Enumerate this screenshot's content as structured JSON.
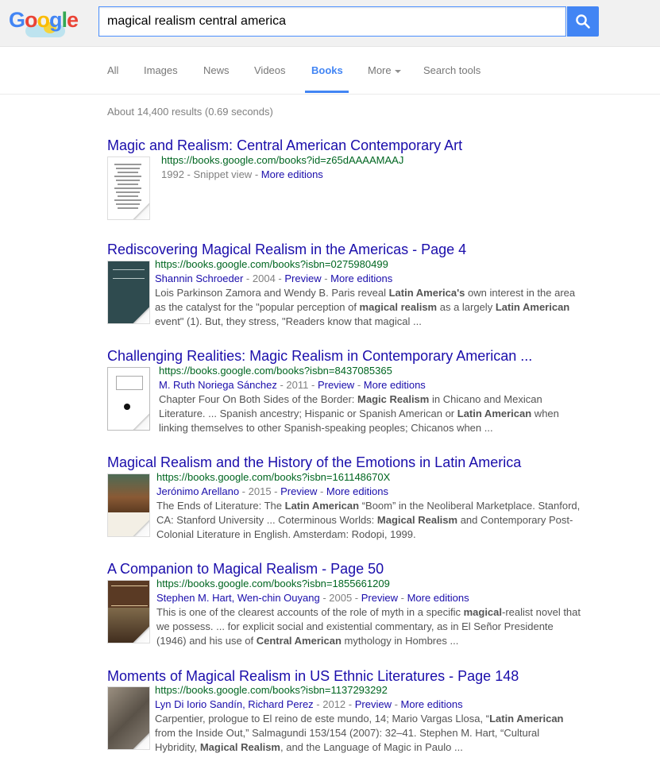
{
  "logo": {
    "letters": [
      "G",
      "o",
      "o",
      "g",
      "l",
      "e"
    ],
    "colors": [
      "#4285f4",
      "#ea4335",
      "#fbbc05",
      "#4285f4",
      "#34a853",
      "#ea4335"
    ]
  },
  "search": {
    "query": "magical realism central america",
    "button_icon": "magnifier-icon"
  },
  "tabs": [
    {
      "label": "All",
      "active": false
    },
    {
      "label": "Images",
      "active": false
    },
    {
      "label": "News",
      "active": false
    },
    {
      "label": "Videos",
      "active": false
    },
    {
      "label": "Books",
      "active": true
    },
    {
      "label": "More",
      "active": false
    },
    {
      "label": "Search tools",
      "active": false
    }
  ],
  "stats": "About 14,400 results (0.69 seconds)",
  "results": [
    {
      "title": "Magic and Realism: Central American Contemporary Art",
      "url": "https://books.google.com/books?id=z65dAAAAMAAJ",
      "authors": "",
      "year": "1992",
      "type": "Snippet view",
      "preview": "",
      "more": "More editions",
      "snippet": [],
      "thumb": {
        "style": "text",
        "bg": "#ffffff"
      }
    },
    {
      "title": "Rediscovering Magical Realism in the Americas - Page 4",
      "url": "https://books.google.com/books?isbn=0275980499",
      "authors": "Shannin Schroeder",
      "year": "2004",
      "type": "",
      "preview": "Preview",
      "more": "More editions",
      "snippet": [
        {
          "t": "Lois Parkinson Zamora and Wendy B. Paris reveal "
        },
        {
          "t": "Latin America's",
          "b": true
        },
        {
          "t": " own interest in the area as the catalyst for the \"popular perception of "
        },
        {
          "t": "magical realism",
          "b": true
        },
        {
          "t": " as a largely "
        },
        {
          "t": "Latin American",
          "b": true
        },
        {
          "t": " event\" (1). But, they stress, \"Readers know that magical ..."
        }
      ],
      "thumb": {
        "style": "dark",
        "bg": "#2f4b4f"
      }
    },
    {
      "title": "Challenging Realities: Magic Realism in Contemporary American ...",
      "url": "https://books.google.com/books?isbn=8437085365",
      "authors": "M. Ruth Noriega Sánchez",
      "year": "2011",
      "type": "",
      "preview": "Preview",
      "more": "More editions",
      "snippet": [
        {
          "t": "Chapter Four On Both Sides of the Border: "
        },
        {
          "t": "Magic Realism",
          "b": true
        },
        {
          "t": " in Chicano and Mexican Literature. ... Spanish ancestry; Hispanic or Spanish American or "
        },
        {
          "t": "Latin American",
          "b": true
        },
        {
          "t": " when linking themselves to other Spanish-speaking peoples; Chicanos when ..."
        }
      ],
      "thumb": {
        "style": "white-dot",
        "bg": "#ffffff"
      }
    },
    {
      "title": "Magical Realism and the History of the Emotions in Latin America",
      "url": "https://books.google.com/books?isbn=161148670X",
      "authors": "Jerónimo Arellano",
      "year": "2015",
      "type": "",
      "preview": "Preview",
      "more": "More editions",
      "snippet": [
        {
          "t": "The Ends of Literature: The "
        },
        {
          "t": "Latin American",
          "b": true
        },
        {
          "t": " “Boom” in the Neoliberal Marketplace. Stanford, CA: Stanford University ... Coterminous Worlds: "
        },
        {
          "t": "Magical Realism",
          "b": true
        },
        {
          "t": " and Contemporary Post-Colonial Literature in English. Amsterdam: Rodopi, 1999."
        }
      ],
      "thumb": {
        "style": "painting",
        "bg": "#6b4b2c"
      }
    },
    {
      "title": "A Companion to Magical Realism - Page 50",
      "url": "https://books.google.com/books?isbn=1855661209",
      "authors": "Stephen M. Hart, Wen-chin Ouyang",
      "year": "2005",
      "type": "",
      "preview": "Preview",
      "more": "More editions",
      "snippet": [
        {
          "t": "This is one of the clearest accounts of the role of myth in a specific "
        },
        {
          "t": "magical",
          "b": true
        },
        {
          "t": "-realist novel that we possess. ... for explicit social and existential commentary, as in El Señor Presidente (1946) and his use of "
        },
        {
          "t": "Central American",
          "b": true
        },
        {
          "t": " mythology in Hombres ..."
        }
      ],
      "thumb": {
        "style": "companion",
        "bg": "#5a3a24"
      }
    },
    {
      "title": "Moments of Magical Realism in US Ethnic Literatures - Page 148",
      "url": "https://books.google.com/books?isbn=1137293292",
      "authors": "Lyn Di Iorio Sandín, Richard Perez",
      "year": "2012",
      "type": "",
      "preview": "Preview",
      "more": "More editions",
      "snippet": [
        {
          "t": "Carpentier, prologue to El reino de este mundo, 14; Mario Vargas Llosa, “"
        },
        {
          "t": "Latin American",
          "b": true
        },
        {
          "t": " from the Inside Out,” Salmagundi 153/154 (2007): 32–41. Stephen M. Hart, “Cultural Hybridity, "
        },
        {
          "t": "Magical Realism",
          "b": true
        },
        {
          "t": ", and the Language of Magic in Paulo ..."
        }
      ],
      "thumb": {
        "style": "moments",
        "bg": "#7a7063"
      }
    }
  ]
}
